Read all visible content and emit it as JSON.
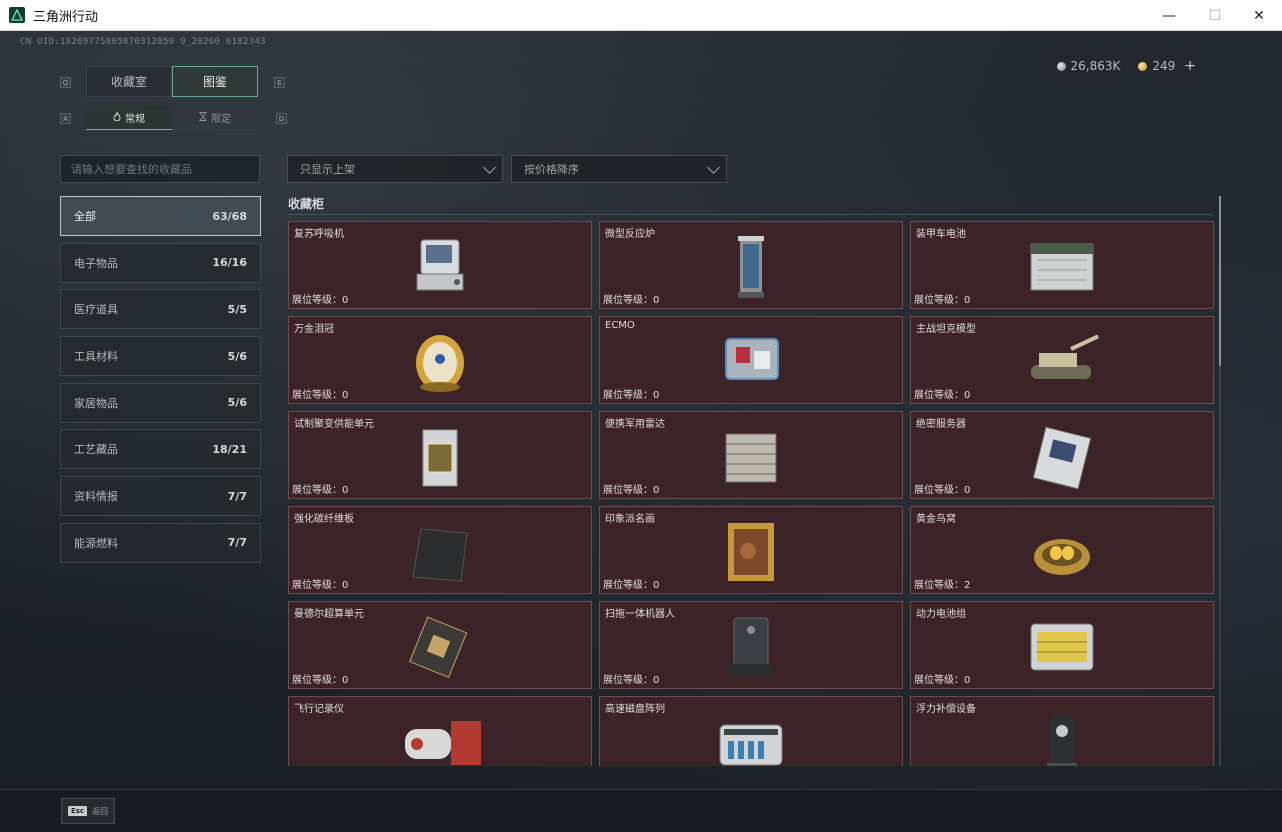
{
  "window": {
    "title": "三角洲行动",
    "minimize_glyph": "—",
    "maximize_glyph": "☐",
    "close_glyph": "✕"
  },
  "uid": "CN UID:18269775805070312850 9_20260 6182343",
  "currency": {
    "silver": "26,863K",
    "gold": "249",
    "plus": "+"
  },
  "key_hints": {
    "q": "Q",
    "e": "E",
    "a": "A",
    "d": "D"
  },
  "tabs": [
    {
      "label": "收藏室"
    },
    {
      "label": "图鉴"
    }
  ],
  "subtabs": [
    {
      "label": "常规"
    },
    {
      "label": "限定"
    }
  ],
  "search": {
    "placeholder": "请输入想要查找的收藏品"
  },
  "filters": {
    "shelf": "只显示上架",
    "sort": "按价格降序"
  },
  "categories": [
    {
      "label": "全部",
      "count": "63/68"
    },
    {
      "label": "电子物品",
      "count": "16/16"
    },
    {
      "label": "医疗道具",
      "count": "5/5"
    },
    {
      "label": "工具材料",
      "count": "5/6"
    },
    {
      "label": "家居物品",
      "count": "5/6"
    },
    {
      "label": "工艺藏品",
      "count": "18/21"
    },
    {
      "label": "资料情报",
      "count": "7/7"
    },
    {
      "label": "能源燃料",
      "count": "7/7"
    }
  ],
  "section_title": "收藏柜",
  "items": [
    {
      "name": "复苏呼吸机",
      "level": "展位等级：0",
      "icon": "ventilator-icon"
    },
    {
      "name": "微型反应炉",
      "level": "展位等级：0",
      "icon": "reactor-icon"
    },
    {
      "name": "装甲车电池",
      "level": "展位等级：0",
      "icon": "battery-icon"
    },
    {
      "name": "万金泪冠",
      "level": "展位等级：0",
      "icon": "jeweled-egg-icon"
    },
    {
      "name": "ECMO",
      "level": "展位等级：0",
      "icon": "ecmo-icon"
    },
    {
      "name": "主战坦克模型",
      "level": "展位等级：0",
      "icon": "tank-icon"
    },
    {
      "name": "试制聚变供能单元",
      "level": "展位等级：0",
      "icon": "fusion-cell-icon"
    },
    {
      "name": "便携军用雷达",
      "level": "展位等级：0",
      "icon": "radar-icon"
    },
    {
      "name": "绝密服务器",
      "level": "展位等级：0",
      "icon": "server-board-icon"
    },
    {
      "name": "强化碳纤维板",
      "level": "展位等级：0",
      "icon": "carbon-plate-icon"
    },
    {
      "name": "印象派名画",
      "level": "展位等级：0",
      "icon": "painting-icon"
    },
    {
      "name": "黄金鸟窝",
      "level": "展位等级：2",
      "icon": "golden-nest-icon"
    },
    {
      "name": "曼德尔超算单元",
      "level": "展位等级：0",
      "icon": "cpu-board-icon"
    },
    {
      "name": "扫拖一体机器人",
      "level": "展位等级：0",
      "icon": "robot-vacuum-icon"
    },
    {
      "name": "动力电池组",
      "level": "展位等级：0",
      "icon": "battery-pack-icon"
    },
    {
      "name": "飞行记录仪",
      "level": "",
      "icon": "flight-recorder-icon"
    },
    {
      "name": "高速磁盘阵列",
      "level": "",
      "icon": "disk-array-icon"
    },
    {
      "name": "浮力补偿设备",
      "level": "",
      "icon": "bcd-icon"
    }
  ],
  "bottom": {
    "esc_key": "Esc",
    "esc_label": "返回"
  },
  "colors": {
    "card_bg": "#3b2327",
    "card_border": "#6c4d52",
    "accent": "#6aa790"
  }
}
